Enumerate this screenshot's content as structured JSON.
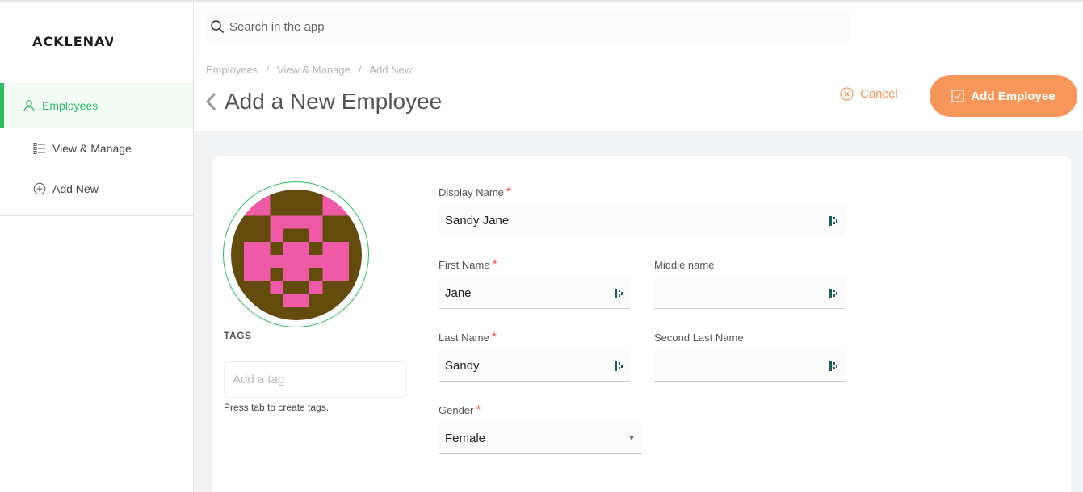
{
  "app": {
    "logo_text": "ACKLENAVENUE"
  },
  "sidebar": {
    "items": [
      {
        "label": "Employees",
        "icon": "user-icon"
      },
      {
        "label": "View & Manage",
        "icon": "list-icon"
      },
      {
        "label": "Add New",
        "icon": "plus-circle-icon"
      }
    ]
  },
  "search": {
    "placeholder": "Search in the app"
  },
  "breadcrumb": [
    "Employees",
    "View & Manage",
    "Add New"
  ],
  "page": {
    "title": "Add a New Employee"
  },
  "actions": {
    "cancel_label": "Cancel",
    "add_label": "Add Employee"
  },
  "profile": {
    "tags_label": "TAGS",
    "tag_placeholder": "Add a tag",
    "tag_hint": "Press tab to create tags."
  },
  "form": {
    "display_name": {
      "label": "Display Name",
      "value": "Sandy Jane"
    },
    "first_name": {
      "label": "First Name",
      "value": "Jane"
    },
    "middle_name": {
      "label": "Middle name",
      "value": ""
    },
    "last_name": {
      "label": "Last Name",
      "value": "Sandy"
    },
    "second_last_name": {
      "label": "Second Last Name",
      "value": ""
    },
    "gender": {
      "label": "Gender",
      "value": "Female"
    }
  },
  "colors": {
    "accent_green": "#2ebc5f",
    "accent_orange": "#f6965a",
    "avatar_bg": "#634b0e",
    "avatar_fg": "#ef5aa7"
  }
}
